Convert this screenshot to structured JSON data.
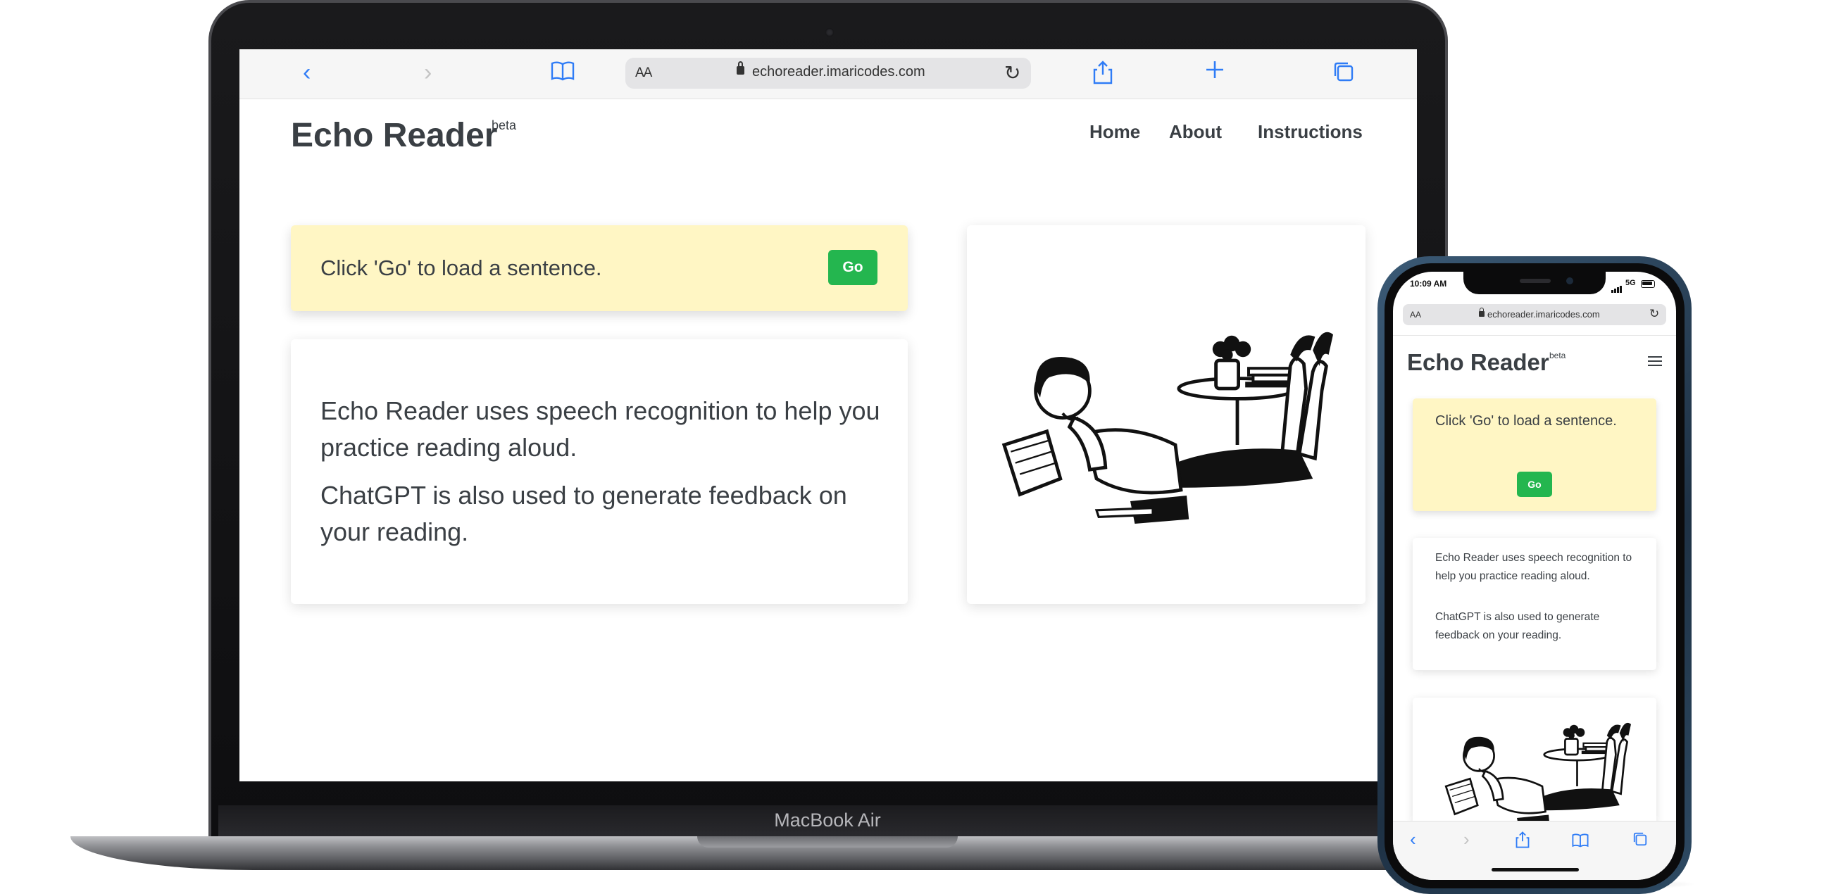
{
  "laptop": {
    "label": "MacBook Air",
    "browser": {
      "text_size_label": "AA",
      "url": "echoreader.imaricodes.com",
      "icons": [
        "back-icon",
        "forward-icon",
        "bookmarks-icon",
        "lock-icon",
        "reload-icon",
        "share-icon",
        "new-tab-icon",
        "tabs-icon"
      ]
    }
  },
  "site": {
    "brand": "Echo Reader",
    "badge": "beta",
    "nav": [
      {
        "label": "Home"
      },
      {
        "label": "About"
      },
      {
        "label": "Instructions"
      }
    ],
    "prompt": {
      "text": "Click 'Go' to load a sentence.",
      "button": "Go"
    },
    "intro": [
      "Echo Reader uses speech recognition to help you practice reading aloud.",
      "ChatGPT is also used to generate feedback on your reading."
    ],
    "illustration": "woman-reading-book-illustration"
  },
  "phone": {
    "status": {
      "time": "10:09 AM",
      "network": "5G"
    },
    "browser": {
      "text_size_label": "AA",
      "url": "echoreader.imaricodes.com"
    },
    "colors": {
      "frame": "#2e4a63"
    }
  },
  "colors": {
    "accent": "#2f7cf6",
    "go_button": "#24b64f",
    "prompt_background": "#fff6c4",
    "text": "#3a3f44"
  }
}
